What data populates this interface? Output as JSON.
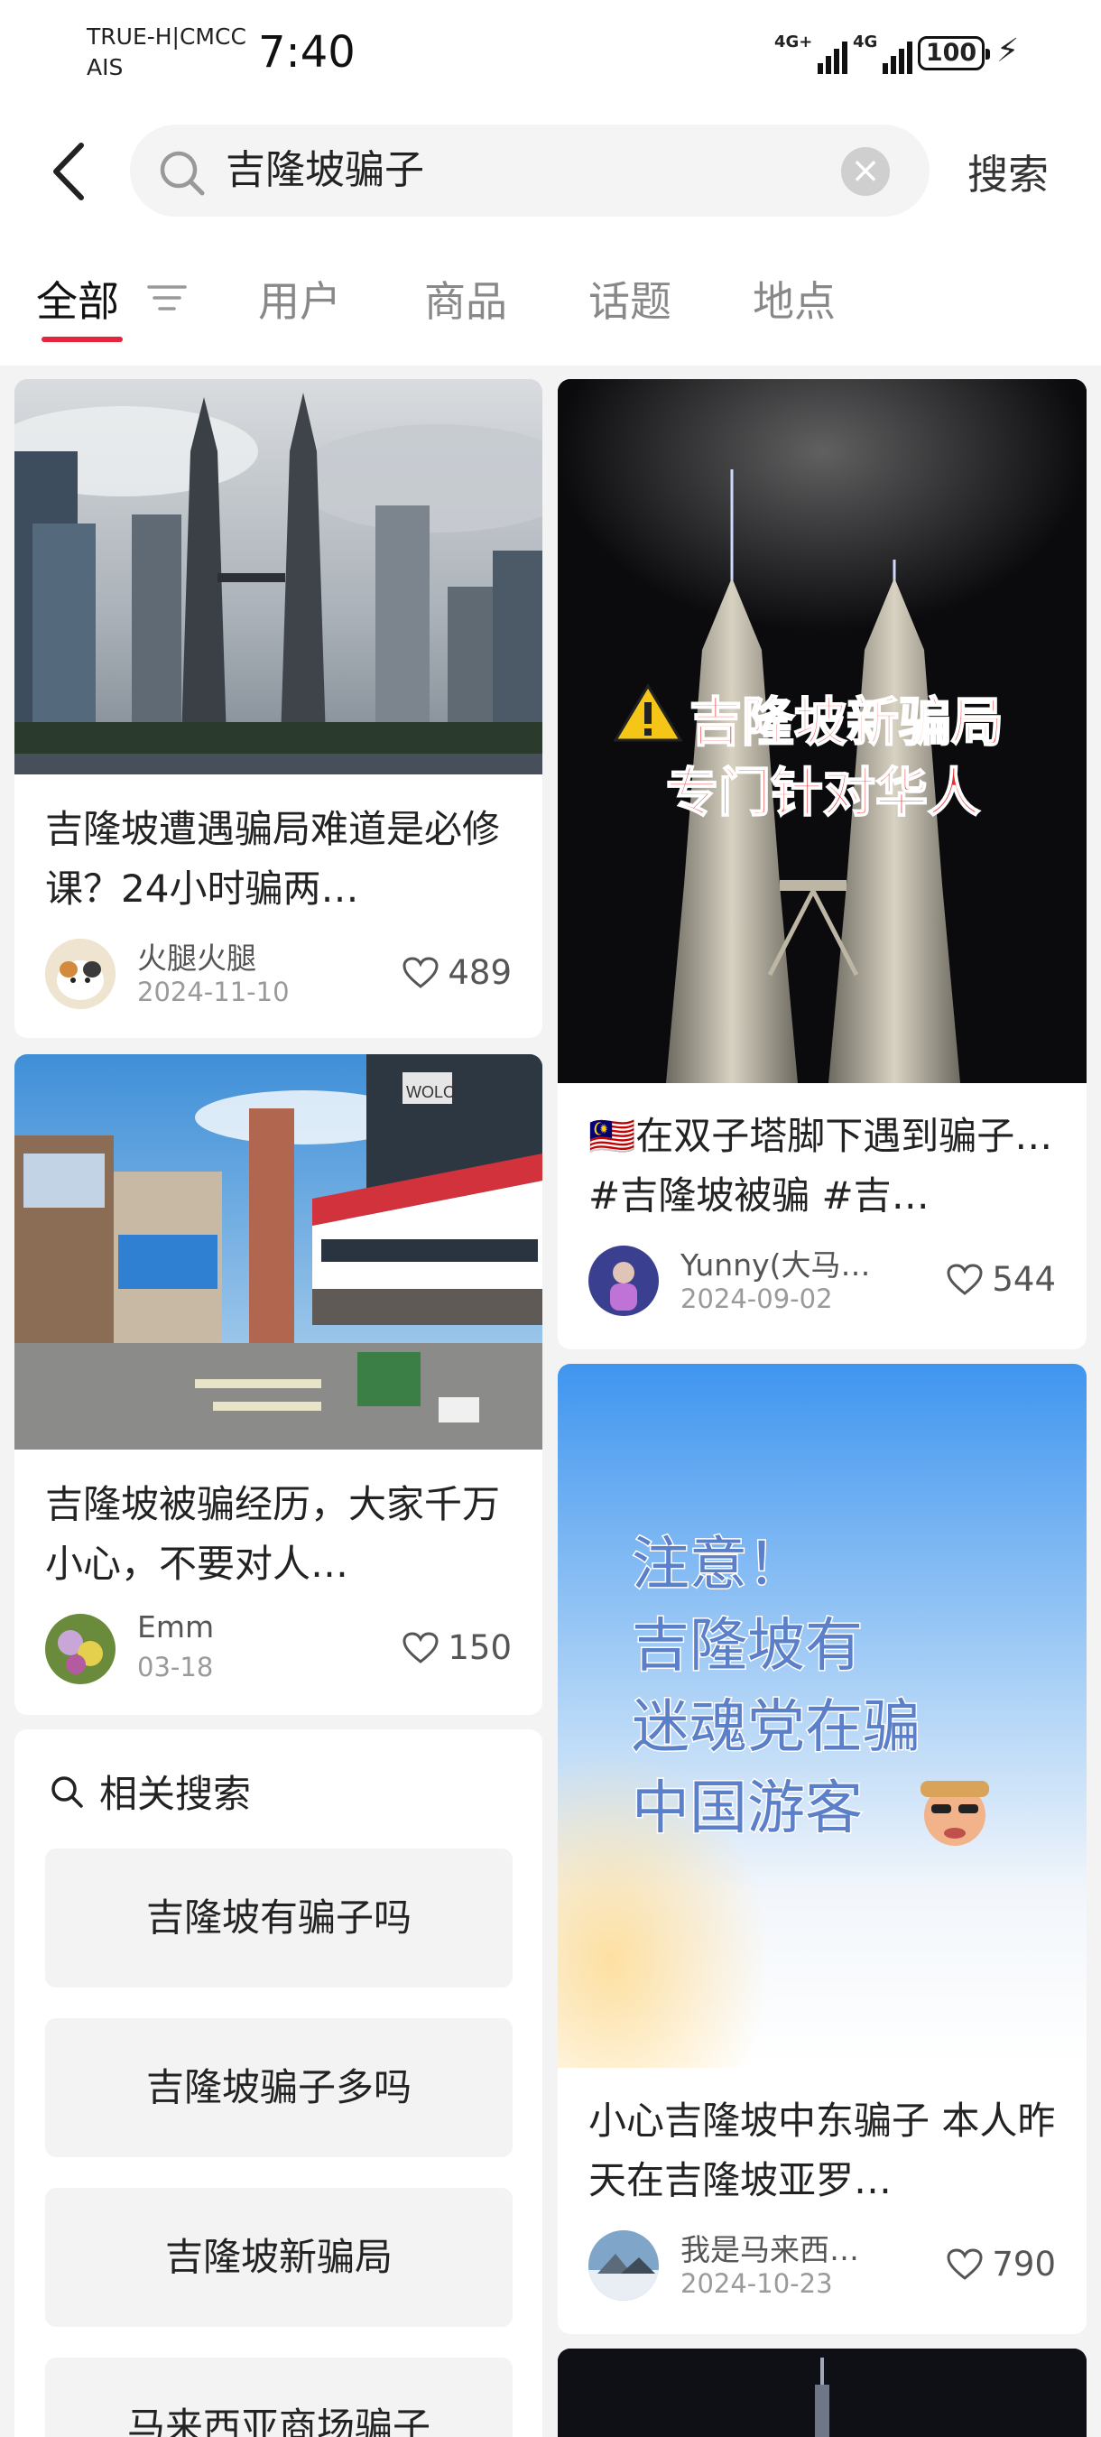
{
  "status_bar": {
    "carrier_1": "TRUE-H|CMCC",
    "carrier_2": "AIS",
    "time": "7:40",
    "signal_1": "4G+",
    "signal_2": "4G",
    "battery": "100"
  },
  "search": {
    "query": "吉隆坡骗子",
    "button": "搜索"
  },
  "tabs": [
    {
      "label": "全部",
      "active": true
    },
    {
      "label": "用户"
    },
    {
      "label": "商品"
    },
    {
      "label": "话题"
    },
    {
      "label": "地点"
    }
  ],
  "posts": [
    {
      "title": "吉隆坡遭遇骗局难道是必修课？24小时骗两…",
      "author": "火腿火腿",
      "date": "2024-11-10",
      "likes": "489"
    },
    {
      "overlay_line1": "吉隆坡新骗局",
      "overlay_line2": "专门针对华人",
      "title": "🇲🇾在双子塔脚下遇到骗子…#吉隆坡被骗 #吉…",
      "author": "Yunny(大马…",
      "date": "2024-09-02",
      "likes": "544"
    },
    {
      "title": "吉隆坡被骗经历，大家千万小心，不要对人…",
      "author": "Emm",
      "date": "03-18",
      "likes": "150",
      "sign_text": "WOLO"
    },
    {
      "overlay_lines": [
        "注意！",
        "吉隆坡有",
        "迷魂党在骗",
        "中国游客"
      ],
      "title": "小心吉隆坡中东骗子 本人昨天在吉隆坡亚罗…",
      "author": "我是马来西…",
      "date": "2024-10-23",
      "likes": "790"
    }
  ],
  "related": {
    "heading": "相关搜索",
    "items": [
      "吉隆坡有骗子吗",
      "吉隆坡骗子多吗",
      "吉隆坡新骗局",
      "马来西亚商场骗子"
    ]
  },
  "colors": {
    "accent": "#e6243d",
    "background": "#f3f3f3"
  }
}
